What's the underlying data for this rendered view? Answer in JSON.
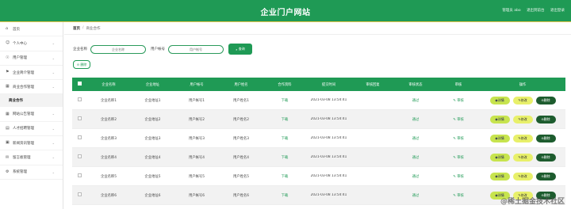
{
  "header": {
    "title": "企业门户网站",
    "links": [
      "管理员 abo",
      "退出到前台",
      "退出登录"
    ]
  },
  "sidebar": {
    "items": [
      {
        "label": "首页",
        "icon": "home-icon"
      },
      {
        "label": "个人中心",
        "icon": "user-icon"
      },
      {
        "label": "用户管理",
        "icon": "users-icon"
      },
      {
        "label": "企业简介管理",
        "icon": "flag-icon"
      },
      {
        "label": "商业合作管理",
        "icon": "grid-icon"
      },
      {
        "label": "商业合作",
        "icon": "",
        "sub": true
      },
      {
        "label": "网站公告管理",
        "icon": "grid-icon"
      },
      {
        "label": "人才招聘管理",
        "icon": "doc-icon"
      },
      {
        "label": "新闻资讯管理",
        "icon": "news-icon"
      },
      {
        "label": "留言板管理",
        "icon": "message-icon"
      },
      {
        "label": "系统管理",
        "icon": "settings-icon"
      }
    ]
  },
  "breadcrumb": {
    "home": "首页",
    "sep": "/",
    "current": "商业合作"
  },
  "search": {
    "company_label": "企业名称",
    "company_placeholder": "企业名称",
    "account_label": "用户帐号",
    "account_placeholder": "用户帐号",
    "search_button": "查询",
    "delete_button": "删除"
  },
  "table": {
    "headers": [
      "企业名称",
      "企业地址",
      "用户帐号",
      "用户姓名",
      "合作资料",
      "提交时间",
      "审核回复",
      "审核状态",
      "审核",
      "操作"
    ],
    "rows": [
      {
        "company": "企业名称1",
        "address": "企业地址1",
        "account": "用户帐号1",
        "name": "用户姓名1",
        "file": "下载",
        "time": "2021-03-08 13:54:41",
        "reply": "",
        "status": "通过",
        "audit": "审核"
      },
      {
        "company": "企业名称2",
        "address": "企业地址2",
        "account": "用户帐号2",
        "name": "用户姓名2",
        "file": "下载",
        "time": "2021-03-08 13:54:41",
        "reply": "",
        "status": "通过",
        "audit": "审核"
      },
      {
        "company": "企业名称3",
        "address": "企业地址3",
        "account": "用户帐号3",
        "name": "用户姓名3",
        "file": "下载",
        "time": "2021-03-08 13:54:41",
        "reply": "",
        "status": "通过",
        "audit": "审核"
      },
      {
        "company": "企业名称4",
        "address": "企业地址4",
        "account": "用户帐号4",
        "name": "用户姓名4",
        "file": "下载",
        "time": "2021-03-08 13:54:41",
        "reply": "",
        "status": "通过",
        "audit": "审核"
      },
      {
        "company": "企业名称5",
        "address": "企业地址5",
        "account": "用户帐号5",
        "name": "用户姓名5",
        "file": "下载",
        "time": "2021-03-08 13:54:41",
        "reply": "",
        "status": "通过",
        "audit": "审核"
      },
      {
        "company": "企业名称6",
        "address": "企业地址6",
        "account": "用户帐号6",
        "name": "用户姓名6",
        "file": "下载",
        "time": "2021-03-08 13:54:41",
        "reply": "",
        "status": "通过",
        "audit": "审核"
      }
    ],
    "actions": {
      "detail": "详情",
      "edit": "修改",
      "delete": "删除"
    }
  },
  "watermark": "@稀土掘金技术社区",
  "colors": {
    "primary": "#1f9a55",
    "accent_yellow": "#e7c54a",
    "detail_btn": "#c7e44e",
    "edit_btn": "#e8f06a",
    "delete_btn": "#1d5c2e"
  }
}
